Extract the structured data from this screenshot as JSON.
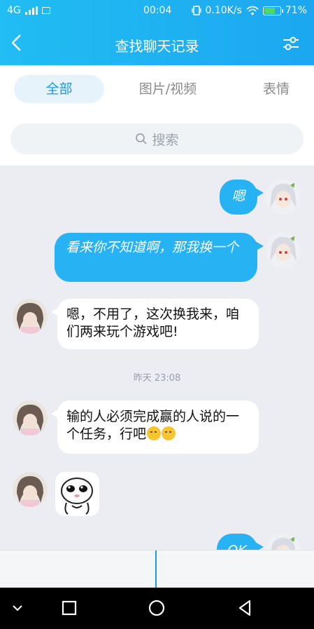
{
  "status_bar": {
    "network": "4G",
    "time": "00:04",
    "speed": "0.10K/s",
    "battery": "71%"
  },
  "nav": {
    "title": "查找聊天记录"
  },
  "tabs": [
    {
      "label": "全部",
      "active": true
    },
    {
      "label": "图片/视频",
      "active": false
    },
    {
      "label": "表情",
      "active": false
    }
  ],
  "search": {
    "placeholder": "搜索"
  },
  "messages": [
    {
      "direction": "out",
      "text": "嗯"
    },
    {
      "direction": "out",
      "text": "看来你不知道啊，那我换一个"
    },
    {
      "direction": "in",
      "text": "嗯，不用了，这次换我来，咱们两来玩个游戏吧!"
    },
    {
      "direction": "in",
      "text": "输的人必须完成赢的人说的一个任务，行吧"
    },
    {
      "direction": "in",
      "type": "sticker"
    },
    {
      "direction": "out",
      "text": "OK"
    }
  ],
  "time_separator": "昨天 23:08",
  "colors": {
    "accent": "#1ca7f0",
    "bubble_out": "#27b3f3",
    "chat_bg": "#ebedf3"
  }
}
